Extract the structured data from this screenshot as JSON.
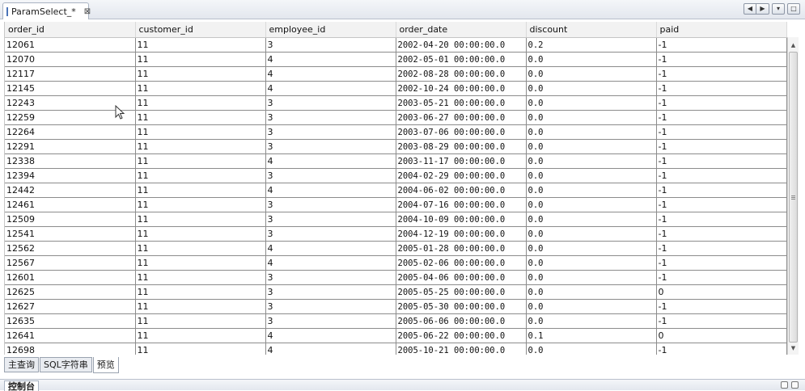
{
  "editor_tab": {
    "title": "ParamSelect_*",
    "close_glyph": "⊠",
    "icon": "table-file-icon"
  },
  "window_controls": {
    "prev": "◀",
    "next": "▶",
    "menu": "▾",
    "maximize": "□"
  },
  "table": {
    "columns": [
      "order_id",
      "customer_id",
      "employee_id",
      "order_date",
      "discount",
      "paid"
    ],
    "rows": [
      [
        "12061",
        "11",
        "3",
        "2002-04-20 00:00:00.0",
        "0.2",
        "-1"
      ],
      [
        "12070",
        "11",
        "4",
        "2002-05-01 00:00:00.0",
        "0.0",
        "-1"
      ],
      [
        "12117",
        "11",
        "4",
        "2002-08-28 00:00:00.0",
        "0.0",
        "-1"
      ],
      [
        "12145",
        "11",
        "4",
        "2002-10-24 00:00:00.0",
        "0.0",
        "-1"
      ],
      [
        "12243",
        "11",
        "3",
        "2003-05-21 00:00:00.0",
        "0.0",
        "-1"
      ],
      [
        "12259",
        "11",
        "3",
        "2003-06-27 00:00:00.0",
        "0.0",
        "-1"
      ],
      [
        "12264",
        "11",
        "3",
        "2003-07-06 00:00:00.0",
        "0.0",
        "-1"
      ],
      [
        "12291",
        "11",
        "3",
        "2003-08-29 00:00:00.0",
        "0.0",
        "-1"
      ],
      [
        "12338",
        "11",
        "4",
        "2003-11-17 00:00:00.0",
        "0.0",
        "-1"
      ],
      [
        "12394",
        "11",
        "3",
        "2004-02-29 00:00:00.0",
        "0.0",
        "-1"
      ],
      [
        "12442",
        "11",
        "4",
        "2004-06-02 00:00:00.0",
        "0.0",
        "-1"
      ],
      [
        "12461",
        "11",
        "3",
        "2004-07-16 00:00:00.0",
        "0.0",
        "-1"
      ],
      [
        "12509",
        "11",
        "3",
        "2004-10-09 00:00:00.0",
        "0.0",
        "-1"
      ],
      [
        "12541",
        "11",
        "3",
        "2004-12-19 00:00:00.0",
        "0.0",
        "-1"
      ],
      [
        "12562",
        "11",
        "4",
        "2005-01-28 00:00:00.0",
        "0.0",
        "-1"
      ],
      [
        "12567",
        "11",
        "4",
        "2005-02-06 00:00:00.0",
        "0.0",
        "-1"
      ],
      [
        "12601",
        "11",
        "3",
        "2005-04-06 00:00:00.0",
        "0.0",
        "-1"
      ],
      [
        "12625",
        "11",
        "3",
        "2005-05-25 00:00:00.0",
        "0.0",
        "0"
      ],
      [
        "12627",
        "11",
        "3",
        "2005-05-30 00:00:00.0",
        "0.0",
        "-1"
      ],
      [
        "12635",
        "11",
        "3",
        "2005-06-06 00:00:00.0",
        "0.0",
        "-1"
      ],
      [
        "12641",
        "11",
        "4",
        "2005-06-22 00:00:00.0",
        "0.1",
        "0"
      ],
      [
        "12698",
        "11",
        "4",
        "2005-10-21 00:00:00.0",
        "0.0",
        "-1"
      ]
    ]
  },
  "scrollbar": {
    "up": "▲",
    "down": "▼"
  },
  "subtabs": [
    "主查询",
    "SQL字符串",
    "预览"
  ],
  "console": {
    "title": "控制台"
  }
}
